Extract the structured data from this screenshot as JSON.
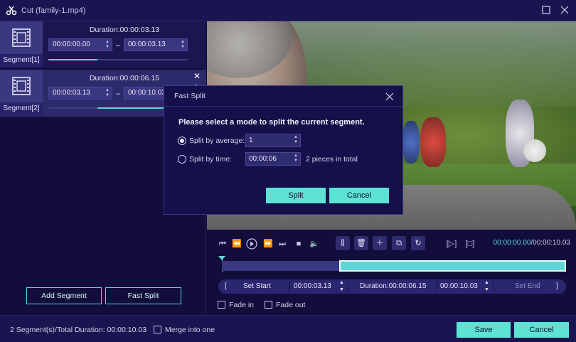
{
  "window": {
    "title": "Cut (family-1.mp4)",
    "app_icon": "scissors-icon"
  },
  "segments": [
    {
      "label": "Segment[1]",
      "duration": "Duration:00:00:03.13",
      "start": "00:00:00.00",
      "end": "00:00:03.13",
      "progress": 0.35
    },
    {
      "label": "Segment[2]",
      "duration": "Duration:00:00:06.15",
      "start": "00:00:03.13",
      "end": "00:00:10.03",
      "progress_start": 0.35,
      "progress_end": 1.0
    }
  ],
  "left_buttons": {
    "add_segment": "Add Segment",
    "fast_split": "Fast Split"
  },
  "dialog": {
    "title": "Fast Split",
    "message": "Please select a mode to split the current segment.",
    "option_average": "Split by average:",
    "average_value": "1",
    "option_time": "Split by time:",
    "time_value": "00:00:06",
    "pieces_text": "2 pieces in total",
    "split_label": "Split",
    "cancel_label": "Cancel",
    "selected_option": "average"
  },
  "player": {
    "current_time": "00:00:00.00",
    "total_time": "/00:00:10.03",
    "selection_start": 0.34,
    "selection_end": 1.0
  },
  "setbar": {
    "bracket_left": "[",
    "set_start": "Set Start",
    "start_time": "00:00:03.13",
    "duration": "Duration:00:00:06.15",
    "end_time": "00:00:10.03",
    "set_end": "Set End",
    "bracket_right": "]"
  },
  "options": {
    "fade_in": "Fade in",
    "fade_out": "Fade out"
  },
  "footer": {
    "summary": "2 Segment(s)/Total Duration: 00:00:10.03",
    "merge_label": "Merge into one",
    "save_label": "Save",
    "cancel_label": "Cancel"
  },
  "colors": {
    "accent": "#5cd6d6",
    "background": "#120d3a",
    "button_fill": "#5ce3d4"
  }
}
